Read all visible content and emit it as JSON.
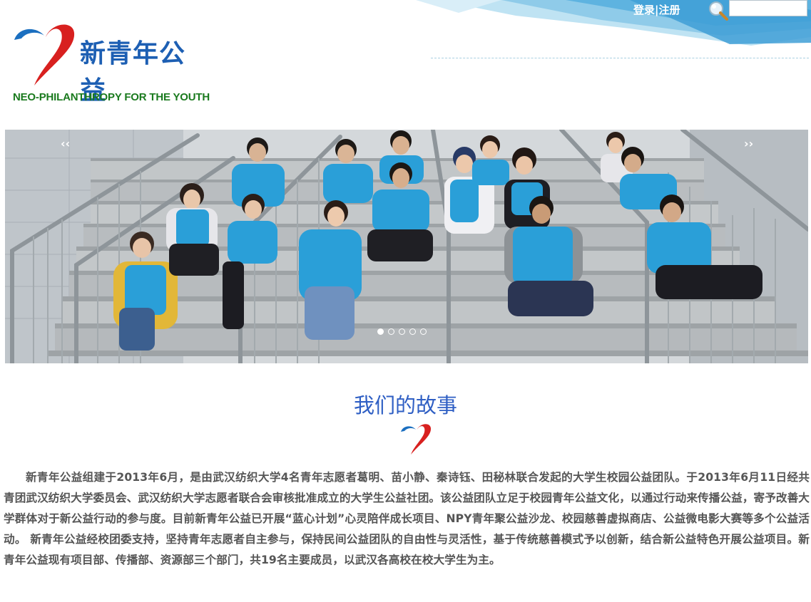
{
  "header": {
    "login_label": "登录",
    "separator": "|",
    "register_label": "注册",
    "search": {
      "placeholder": "",
      "value": ""
    }
  },
  "logo": {
    "name_cn": "新青年公益",
    "name_en": "NEO-PHILANTHROPY FOR THE YOUTH",
    "colors": {
      "heart_blue": "#1b6fc0",
      "heart_red": "#d8201f",
      "text_blue": "#1d5fb3",
      "text_green": "#1a7a1e"
    }
  },
  "carousel": {
    "prev_arrow": "‹‹",
    "next_arrow": "››",
    "slide_count": 5,
    "active_index": 0
  },
  "story": {
    "title": "我们的故事",
    "body": "新青年公益组建于2013年6月，是由武汉纺织大学4名青年志愿者葛明、苗小静、秦诗钰、田秘林联合发起的大学生校园公益团队。于2013年6月11日经共青团武汉纺织大学委员会、武汉纺织大学志愿者联合会审核批准成立的大学生公益社团。该公益团队立足于校园青年公益文化，以通过行动来传播公益，寄予改善大学群体对于新公益行动的参与度。目前新青年公益已开展“蓝心计划”心灵陪伴成长项目、NPY青年聚公益沙龙、校园慈善虚拟商店、公益微电影大赛等多个公益活动。 新青年公益经校团委支持，坚持青年志愿者自主参与，保持民间公益团队的自由性与灵活性，基于传统慈善模式予以创新，结合新公益特色开展公益项目。新青年公益现有项目部、传播部、资源部三个部门，共19名主要成员，以武汉各高校在校大学生为主。"
  },
  "colors": {
    "accent_blue": "#2f5fc4",
    "banner_blue": "#4fa6d6",
    "vest_blue": "#2a9fd8",
    "body_text": "#555555"
  }
}
